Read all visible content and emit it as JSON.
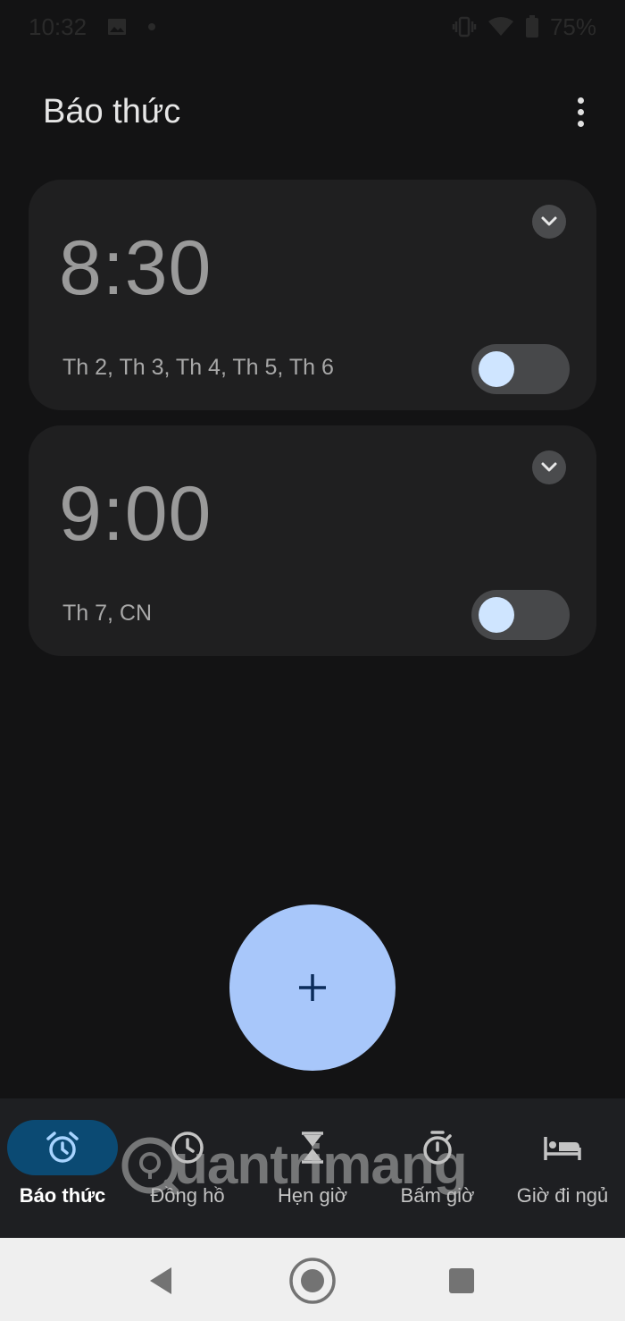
{
  "status_bar": {
    "time": "10:32",
    "battery": "75%"
  },
  "app_bar": {
    "title": "Báo thức"
  },
  "alarms": [
    {
      "time": "8:30",
      "days": "Th 2, Th 3, Th 4, Th 5, Th 6",
      "enabled": false
    },
    {
      "time": "9:00",
      "days": "Th 7, CN",
      "enabled": false
    }
  ],
  "fab": {
    "label": "+"
  },
  "bottom_nav": [
    {
      "label": "Báo thức",
      "icon": "alarm-clock-icon",
      "active": true
    },
    {
      "label": "Đồng hồ",
      "icon": "clock-icon",
      "active": false
    },
    {
      "label": "Hẹn giờ",
      "icon": "hourglass-icon",
      "active": false
    },
    {
      "label": "Bấm giờ",
      "icon": "stopwatch-icon",
      "active": false
    },
    {
      "label": "Giờ đi ngủ",
      "icon": "bed-icon",
      "active": false
    }
  ],
  "watermark": {
    "text": "uantrimang"
  },
  "colors": {
    "background": "#131314",
    "card": "#1f1f20",
    "fab": "#a8c7fa",
    "nav_active": "#0b4a73",
    "toggle_knob": "#cfe5ff"
  }
}
